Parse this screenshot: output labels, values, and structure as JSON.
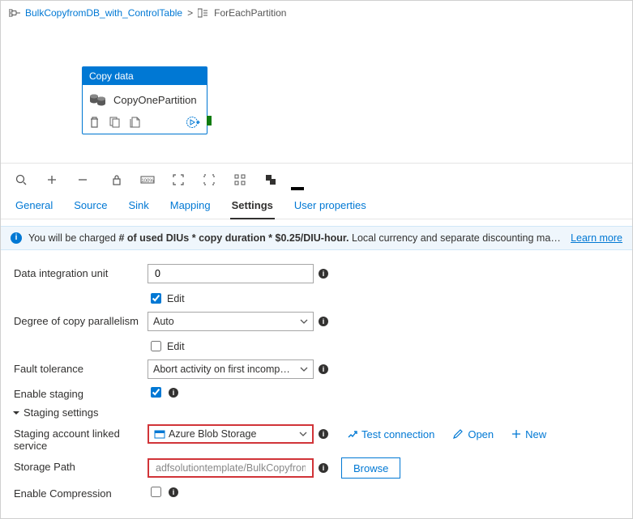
{
  "breadcrumb": {
    "parent": "BulkCopyfromDB_with_ControlTable",
    "sep": ">",
    "current": "ForEachPartition"
  },
  "activity": {
    "type_label": "Copy data",
    "name": "CopyOnePartition"
  },
  "tabs": {
    "general": "General",
    "source": "Source",
    "sink": "Sink",
    "mapping": "Mapping",
    "settings": "Settings",
    "user_props": "User properties"
  },
  "infobar": {
    "prefix": "You will be charged",
    "bold": "# of used DIUs * copy duration * $0.25/DIU-hour.",
    "suffix": "Local currency and separate discounting may apply per subscription type.",
    "learn": "Learn more"
  },
  "form": {
    "diu_label": "Data integration unit",
    "diu_value": "0",
    "edit": "Edit",
    "dop_label": "Degree of copy parallelism",
    "dop_value": "Auto",
    "fault_label": "Fault tolerance",
    "fault_value": "Abort activity on first incompatible row",
    "staging_label": "Enable staging",
    "staging_section": "Staging settings",
    "linked_service_label": "Staging account linked service",
    "linked_service_value": "Azure Blob Storage",
    "test_conn": "Test connection",
    "open": "Open",
    "new": "New",
    "storage_path_label": "Storage Path",
    "storage_path_value": "adfsolutiontemplate/BulkCopyfromDB_with_Co",
    "browse": "Browse",
    "enable_compression_label": "Enable Compression"
  }
}
